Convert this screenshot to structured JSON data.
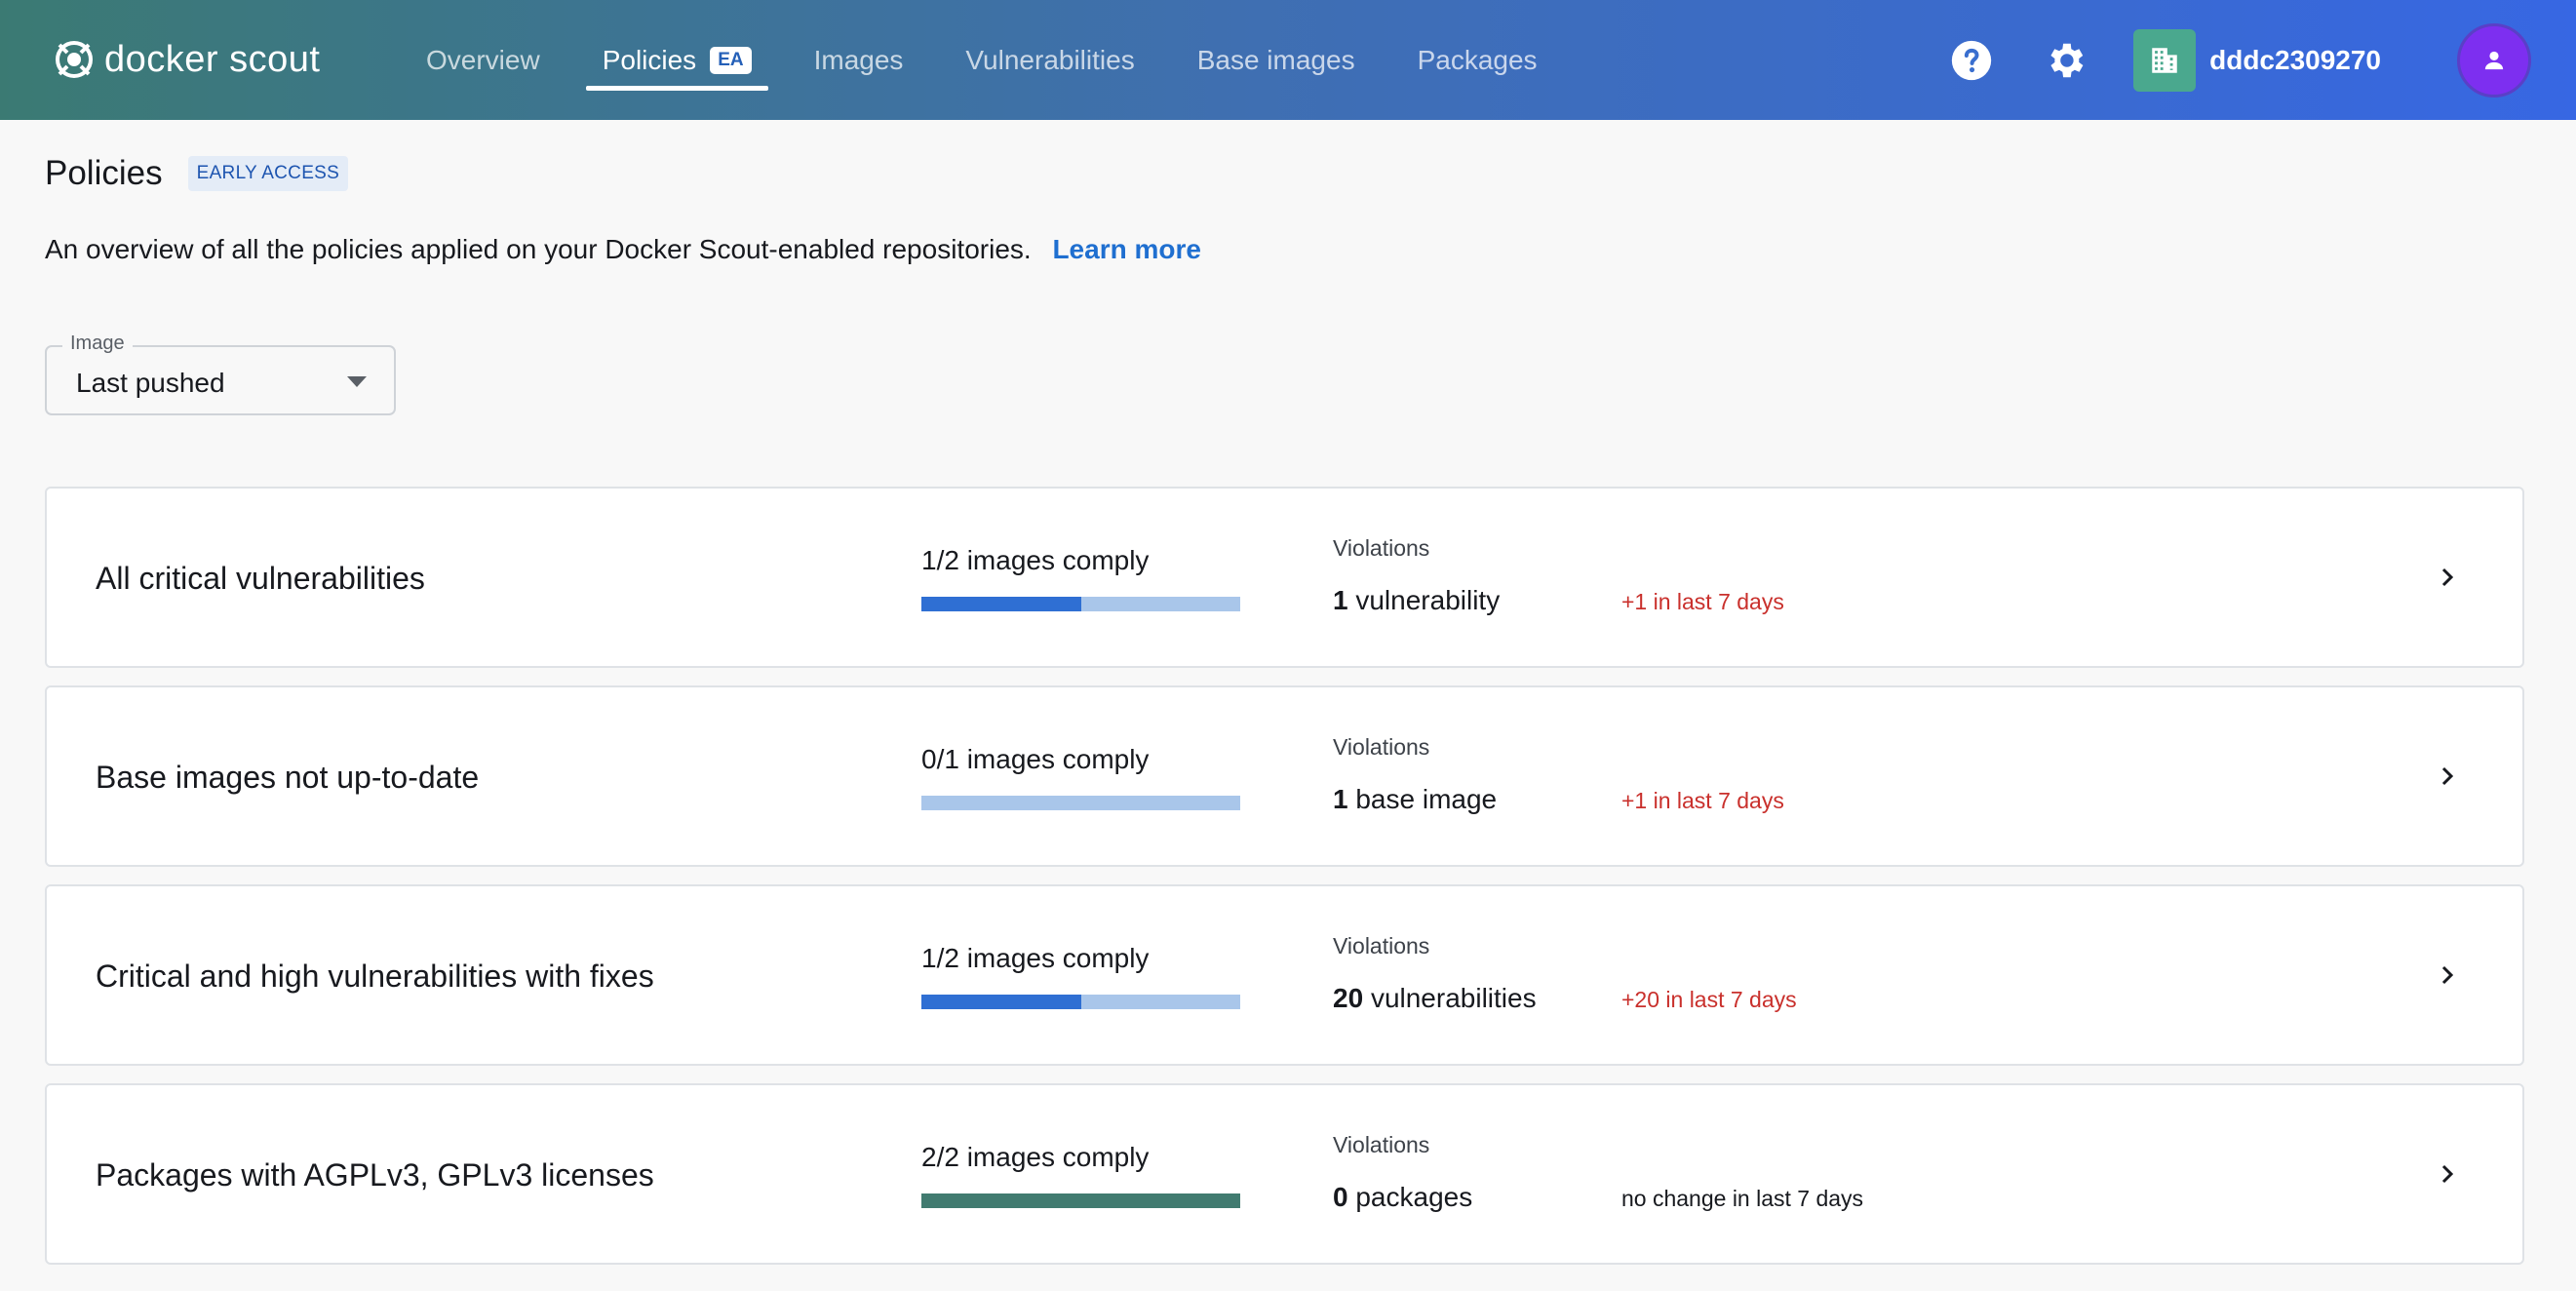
{
  "header": {
    "logo_text": "docker scout",
    "tabs": [
      {
        "label": "Overview",
        "active": false
      },
      {
        "label": "Policies",
        "active": true,
        "badge": "EA"
      },
      {
        "label": "Images",
        "active": false
      },
      {
        "label": "Vulnerabilities",
        "active": false
      },
      {
        "label": "Base images",
        "active": false
      },
      {
        "label": "Packages",
        "active": false
      }
    ],
    "help_icon": "help-circle-icon",
    "settings_icon": "gear-icon",
    "org_name": "dddc2309270",
    "org_icon": "building-icon",
    "user_icon": "person-icon"
  },
  "page": {
    "title": "Policies",
    "badge": "EARLY ACCESS",
    "intro": "An overview of all the policies applied on your Docker Scout-enabled repositories.",
    "learn_more": "Learn more"
  },
  "filter": {
    "label": "Image",
    "value": "Last pushed"
  },
  "colors": {
    "bar_track": "#a9c6ea",
    "bar_partial": "#2f6fd3",
    "bar_complete": "#417b70",
    "delta_up": "#c9302c",
    "delta_neutral": "#17191e"
  },
  "policies": [
    {
      "name": "All critical vulnerabilities",
      "comply_text": "1/2 images comply",
      "comply_fraction": 0.5,
      "violations_label": "Violations",
      "violations_count": "1",
      "violations_unit": "vulnerability",
      "delta": "+1 in last 7 days",
      "delta_type": "up"
    },
    {
      "name": "Base images not up-to-date",
      "comply_text": "0/1 images comply",
      "comply_fraction": 0,
      "violations_label": "Violations",
      "violations_count": "1",
      "violations_unit": "base image",
      "delta": "+1 in last 7 days",
      "delta_type": "up"
    },
    {
      "name": "Critical and high vulnerabilities with fixes",
      "comply_text": "1/2 images comply",
      "comply_fraction": 0.5,
      "violations_label": "Violations",
      "violations_count": "20",
      "violations_unit": "vulnerabilities",
      "delta": "+20 in last 7 days",
      "delta_type": "up"
    },
    {
      "name": "Packages with AGPLv3, GPLv3 licenses",
      "comply_text": "2/2 images comply",
      "comply_fraction": 1,
      "violations_label": "Violations",
      "violations_count": "0",
      "violations_unit": "packages",
      "delta": "no change in last 7 days",
      "delta_type": "neutral"
    }
  ]
}
